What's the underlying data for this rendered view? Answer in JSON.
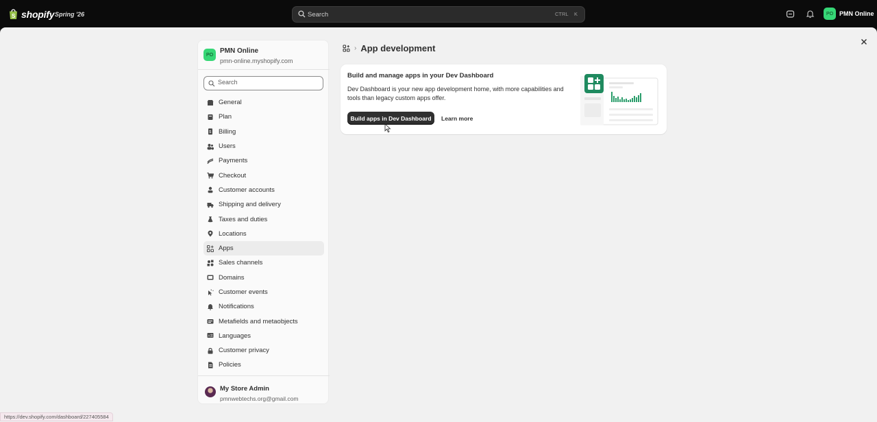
{
  "topbar": {
    "brand": "shopify",
    "edition": "Spring '26",
    "search_placeholder": "Search",
    "shortcut_ctrl": "CTRL",
    "shortcut_key": "K",
    "user_initials": "PO",
    "user_name": "PMN Online"
  },
  "nav": {
    "store_initials": "PO",
    "store_name": "PMN Online",
    "store_url": "pmn-online.myshopify.com",
    "search_placeholder": "Search",
    "items": [
      {
        "label": "General",
        "icon": "store-icon"
      },
      {
        "label": "Plan",
        "icon": "plan-icon"
      },
      {
        "label": "Billing",
        "icon": "receipt-icon"
      },
      {
        "label": "Users",
        "icon": "users-icon"
      },
      {
        "label": "Payments",
        "icon": "payments-icon"
      },
      {
        "label": "Checkout",
        "icon": "cart-icon"
      },
      {
        "label": "Customer accounts",
        "icon": "person-icon"
      },
      {
        "label": "Shipping and delivery",
        "icon": "truck-icon"
      },
      {
        "label": "Taxes and duties",
        "icon": "tax-icon"
      },
      {
        "label": "Locations",
        "icon": "location-icon"
      },
      {
        "label": "Apps",
        "icon": "apps-icon",
        "active": true
      },
      {
        "label": "Sales channels",
        "icon": "channels-icon"
      },
      {
        "label": "Domains",
        "icon": "globe-icon"
      },
      {
        "label": "Customer events",
        "icon": "cursor-icon"
      },
      {
        "label": "Notifications",
        "icon": "bell-icon"
      },
      {
        "label": "Metafields and metaobjects",
        "icon": "database-icon"
      },
      {
        "label": "Languages",
        "icon": "languages-icon"
      },
      {
        "label": "Customer privacy",
        "icon": "lock-icon"
      },
      {
        "label": "Policies",
        "icon": "document-icon"
      }
    ],
    "admin_name": "My Store Admin",
    "admin_email": "pmnwebtechs.org@gmail.com"
  },
  "content": {
    "page_title": "App development",
    "card_title": "Build and manage apps in your Dev Dashboard",
    "card_description": "Dev Dashboard is your new app development home, with more capabilities and tools than legacy custom apps offer.",
    "primary_button": "Build apps in Dev Dashboard",
    "secondary_button": "Learn more"
  },
  "status_url": "https://dev.shopify.com/dashboard/227405584",
  "colors": {
    "topbar_bg": "#0b0b0b",
    "avatar_green": "#36d776",
    "brand_green": "#1f8a5f",
    "primary_button": "#303030"
  }
}
